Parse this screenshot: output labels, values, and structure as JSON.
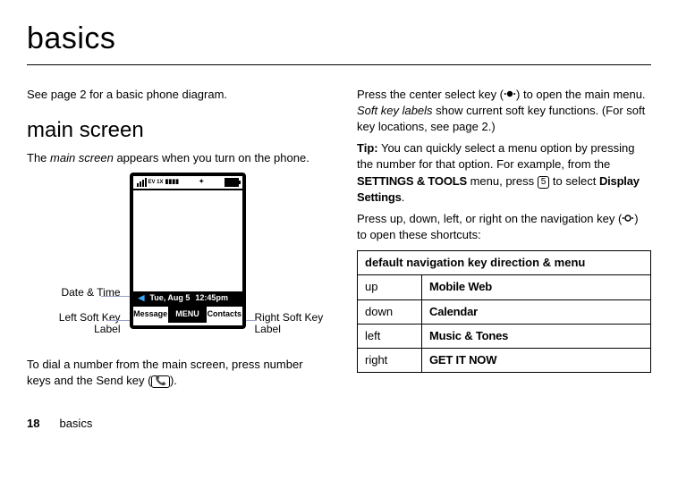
{
  "title": "basics",
  "left": {
    "intro": "See page 2 for a basic phone diagram.",
    "section": "main screen",
    "desc_pre": "The ",
    "desc_ital": "main screen",
    "desc_post": " appears when you turn on the phone.",
    "callout_date": "Date & Time",
    "callout_left": "Left Soft Key Label",
    "callout_right": "Right Soft Key Label",
    "phone": {
      "status_net": "EV 1X",
      "date": "Tue, Aug 5",
      "time": "12:45pm",
      "soft_left": "Message",
      "soft_mid": "MENU",
      "soft_right": "Contacts"
    },
    "dial_pre": "To dial a number from the main screen, press number keys and the Send key (",
    "dial_key": "📞",
    "dial_post": ")."
  },
  "right": {
    "p1_pre": "Press the center select key (",
    "p1_post": ") to open the main menu. ",
    "p1_ital": "Soft key labels",
    "p1_tail": " show current soft key functions. (For soft key locations, see page 2.)",
    "tip_label": "Tip:",
    "tip_body_a": " You can quickly select a menu option by pressing the number for that option. For example, from the ",
    "tip_menu": "SETTINGS & TOOLS",
    "tip_body_b": " menu, press ",
    "tip_key": "5",
    "tip_body_c": " to select ",
    "tip_target": "Display Settings",
    "tip_body_d": ".",
    "p3_pre": "Press up, down, left, or right on the navigation key (",
    "p3_post": ") to open these shortcuts:",
    "table_header": "default navigation key direction & menu",
    "rows": [
      {
        "dir": "up",
        "menu": "Mobile Web"
      },
      {
        "dir": "down",
        "menu": "Calendar"
      },
      {
        "dir": "left",
        "menu": "Music & Tones"
      },
      {
        "dir": "right",
        "menu": "GET IT NOW"
      }
    ]
  },
  "footer": {
    "page": "18",
    "section": "basics"
  }
}
